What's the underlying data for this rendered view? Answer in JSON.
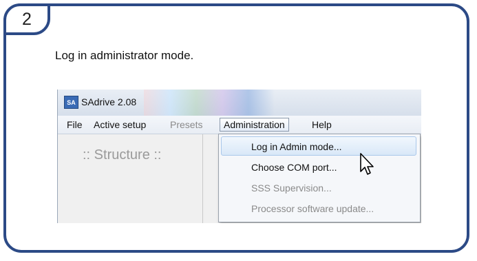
{
  "step": {
    "number": "2"
  },
  "instruction": "Log in administrator mode.",
  "window": {
    "title": "SAdrive 2.08",
    "icon_text": "SA",
    "icon": "sadrive-app-icon"
  },
  "menubar": {
    "items": [
      {
        "label": "File",
        "state": "enabled"
      },
      {
        "label": "Active setup",
        "state": "enabled"
      },
      {
        "label": "Presets",
        "state": "disabled"
      },
      {
        "label": "Administration",
        "state": "open"
      },
      {
        "label": "Help",
        "state": "enabled"
      }
    ]
  },
  "pane": {
    "heading": ":: Structure ::"
  },
  "dropdown": {
    "items": [
      {
        "label": "Log in Admin mode...",
        "state": "highlighted"
      },
      {
        "label": "Choose COM port...",
        "state": "enabled"
      },
      {
        "label": "SSS Supervision...",
        "state": "disabled"
      },
      {
        "label": "Processor software update...",
        "state": "disabled"
      }
    ]
  },
  "cursor": {
    "icon": "arrow-cursor-icon"
  },
  "colors": {
    "frame_border": "#2c4a86",
    "highlight": "#d9e8f8",
    "disabled_text": "#8a8a8a"
  }
}
